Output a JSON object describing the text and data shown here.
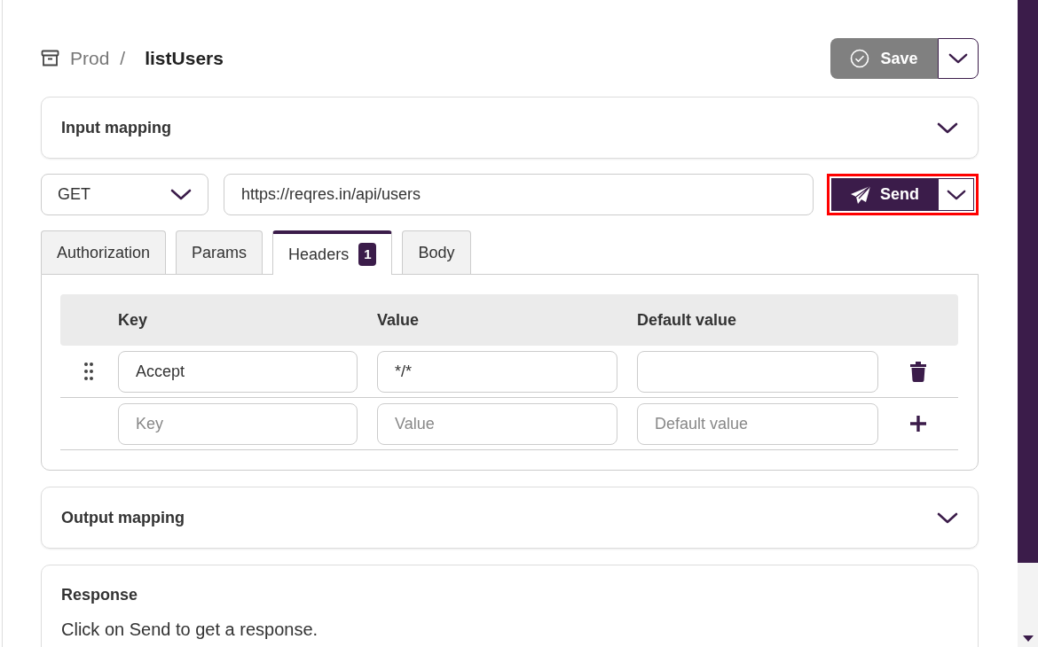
{
  "breadcrumb": {
    "parent": "Prod",
    "separator": "/",
    "current": "listUsers"
  },
  "save_button": {
    "label": "Save",
    "disabled": true
  },
  "input_mapping": {
    "title": "Input mapping",
    "expanded": false
  },
  "request": {
    "method": "GET",
    "url": "https://reqres.in/api/users",
    "send_label": "Send",
    "highlighted": true
  },
  "tabs": [
    {
      "label": "Authorization",
      "selected": false
    },
    {
      "label": "Params",
      "selected": false
    },
    {
      "label": "Headers",
      "badge": "1",
      "selected": true
    },
    {
      "label": "Body",
      "selected": false
    }
  ],
  "headers_table": {
    "columns": [
      "Key",
      "Value",
      "Default value"
    ],
    "rows": [
      {
        "kind": "entry",
        "key": "Accept",
        "value": "*/*"
      },
      {
        "kind": "new",
        "key_placeholder": "Key",
        "value_placeholder": "Value",
        "default_placeholder": "Default value"
      }
    ]
  },
  "output_mapping": {
    "title": "Output mapping",
    "expanded": false
  },
  "response": {
    "title": "Response",
    "message": "Click on Send to get a response."
  }
}
